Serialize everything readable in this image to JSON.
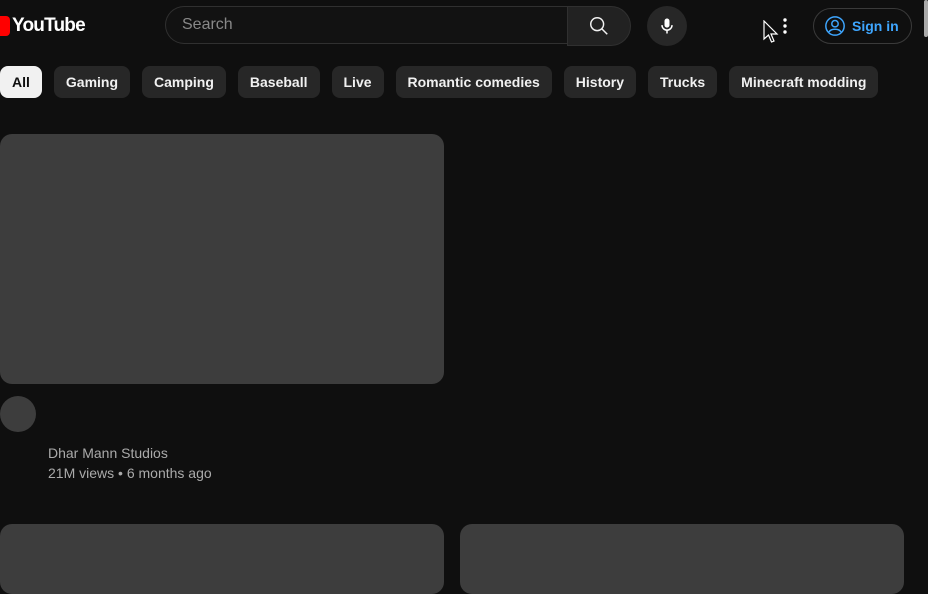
{
  "header": {
    "logo_text": "YouTube",
    "search_placeholder": "Search",
    "signin_label": "Sign in"
  },
  "chips": [
    "All",
    "Gaming",
    "Camping",
    "Baseball",
    "Live",
    "Romantic comedies",
    "History",
    "Trucks",
    "Minecraft modding"
  ],
  "active_chip": "All",
  "feed": {
    "videos": [
      {
        "channel": "Dhar Mann Studios",
        "views": "21M views",
        "separator": "•",
        "age": "6 months ago"
      }
    ]
  },
  "colors": {
    "background": "#0f0f0f",
    "thumbnail_placeholder": "#3d3d3d",
    "chip": "#272727",
    "chip_active": "#f1f1f1",
    "brand_red": "#ff0000",
    "link_blue": "#3ea6ff"
  },
  "icons": [
    "youtube-logo-icon",
    "search-icon",
    "mic-icon",
    "more-vert-icon",
    "account-circle-icon",
    "mouse-cursor-icon"
  ]
}
